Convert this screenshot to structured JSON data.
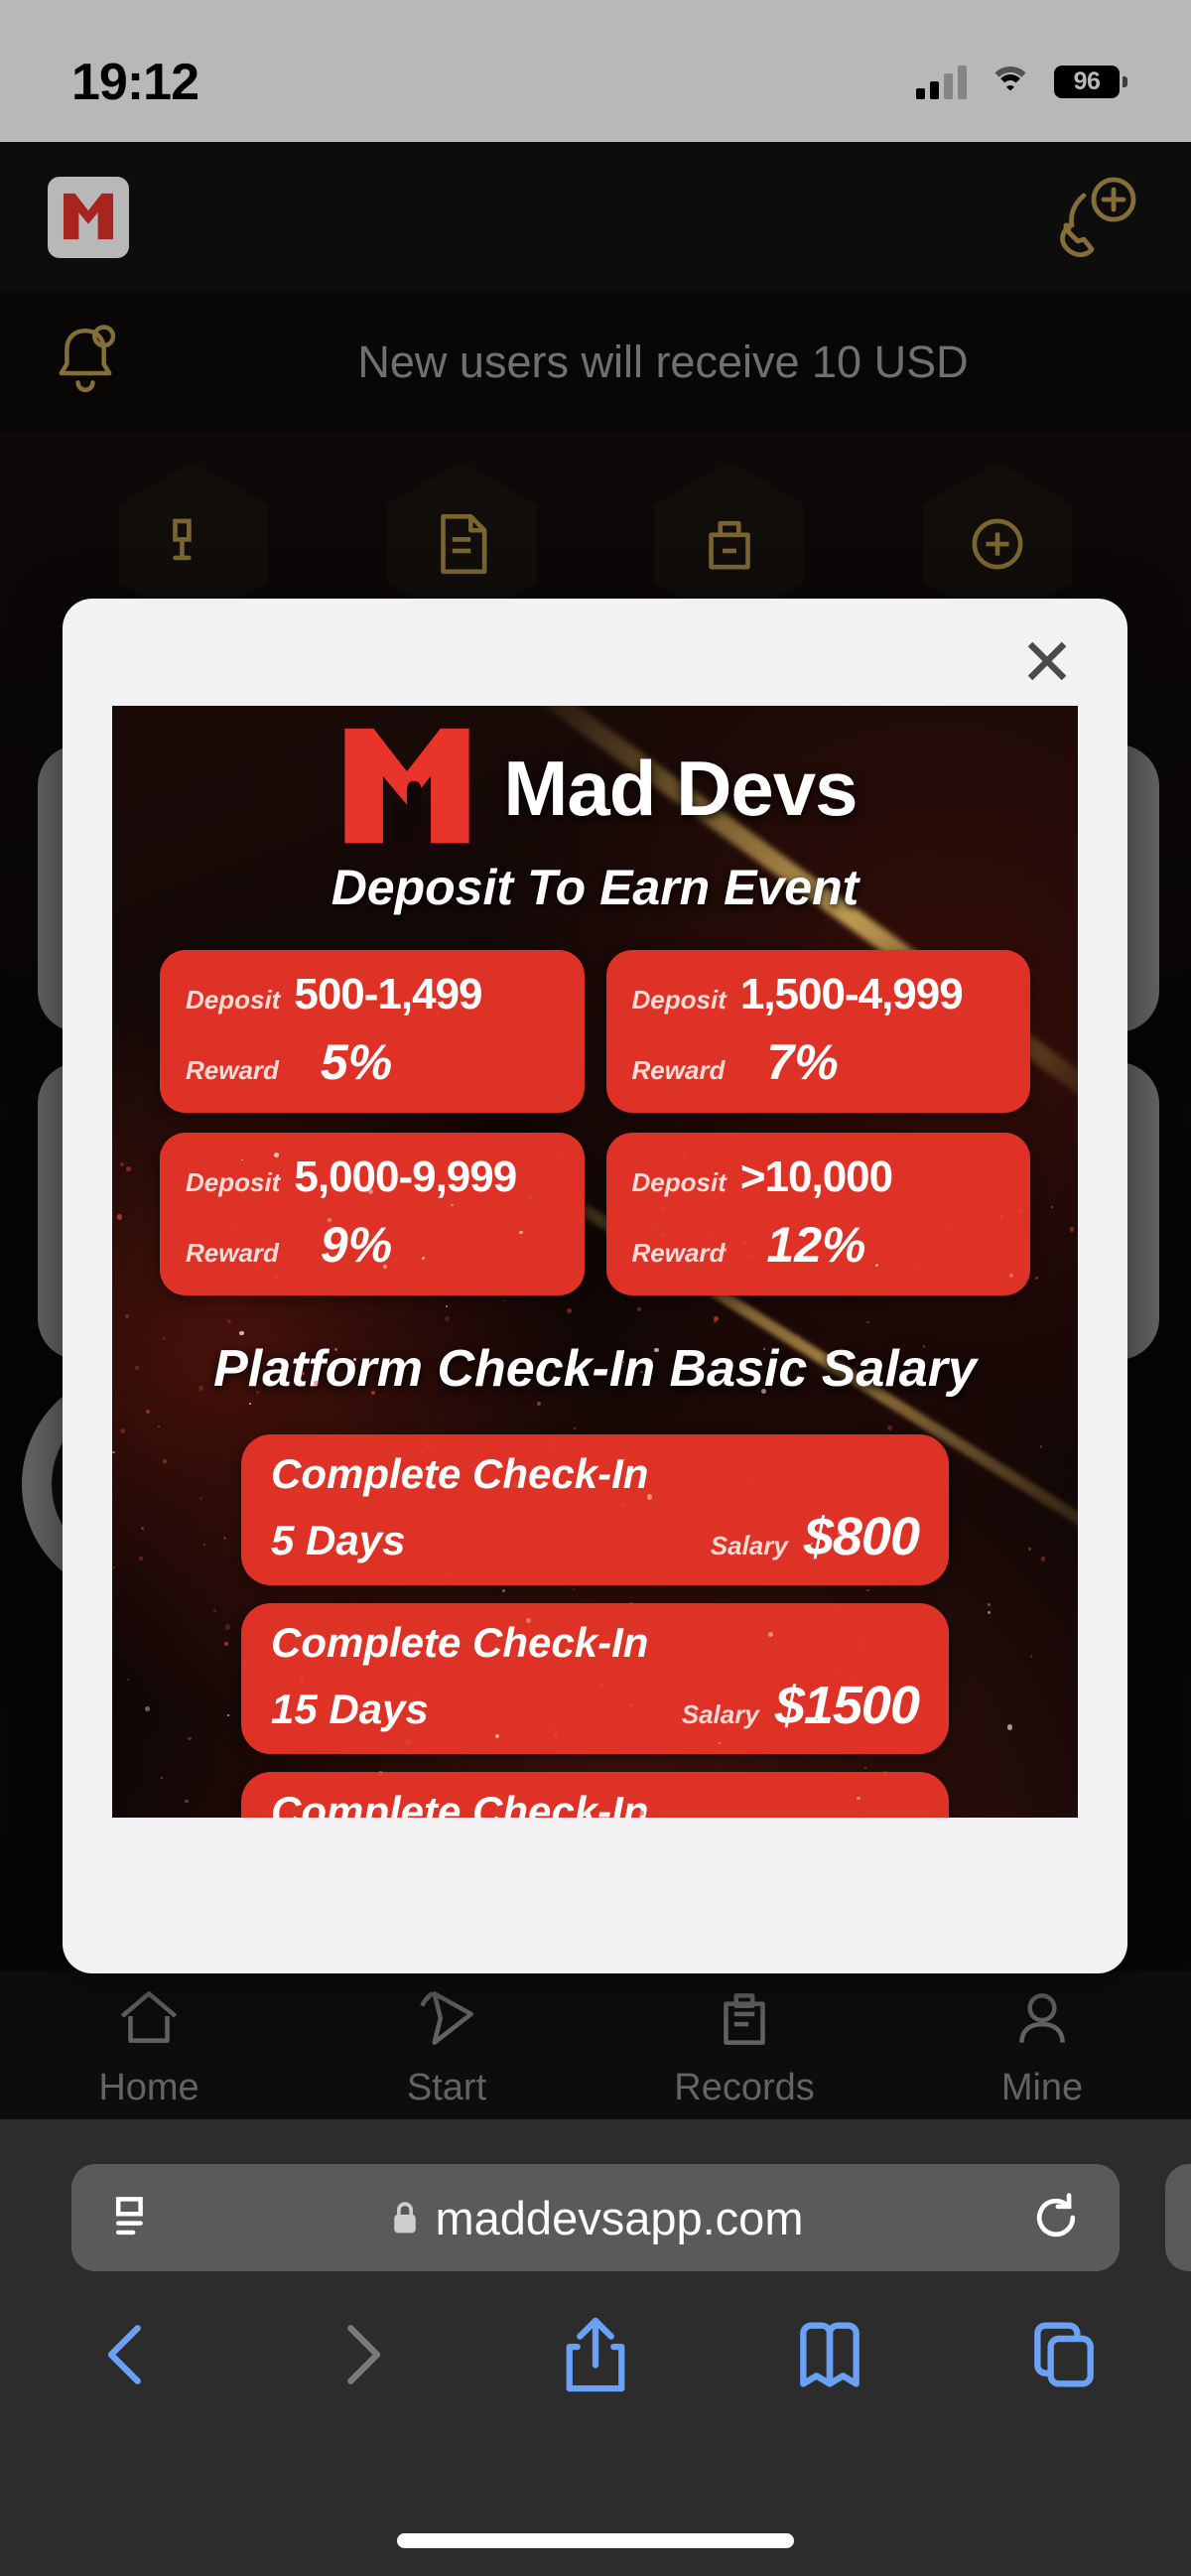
{
  "status_bar": {
    "time": "19:12",
    "battery_percent": "96",
    "signal_icon": "cellular-bars-icon",
    "wifi_icon": "wifi-icon",
    "battery_icon": "battery-icon"
  },
  "app_header": {
    "logo_icon": "mad-devs-m-logo",
    "support_icon": "customer-service-phone-icon"
  },
  "notice": {
    "bell_icon": "notification-bell-icon",
    "text": "New users will receive 10 USD"
  },
  "quick_actions": [
    {
      "name": "quick-action-qr",
      "icon": "qr-scan-icon"
    },
    {
      "name": "quick-action-document",
      "icon": "document-icon"
    },
    {
      "name": "quick-action-wallet",
      "icon": "wallet-person-icon"
    },
    {
      "name": "quick-action-add",
      "icon": "add-diamond-icon"
    }
  ],
  "modal": {
    "close_label": "✕",
    "brand_name": "Mad Devs",
    "brand_logo_icon": "mad-devs-rock-hand-logo",
    "event_title": "Deposit To Earn Event",
    "deposit_label": "Deposit",
    "reward_label": "Reward",
    "tiers": [
      {
        "deposit_label": "Deposit",
        "range": "500-1,499",
        "reward_label": "Reward",
        "reward": "5%"
      },
      {
        "deposit_label": "Deposit",
        "range": "1,500-4,999",
        "reward_label": "Reward",
        "reward": "7%"
      },
      {
        "deposit_label": "Deposit",
        "range": "5,000-9,999",
        "reward_label": "Reward",
        "reward": "9%"
      },
      {
        "deposit_label": "Deposit",
        "range": ">10,000",
        "reward_label": "Reward",
        "reward": "12%"
      }
    ],
    "checkin_section_title": "Platform Check-In Basic Salary",
    "checkins": [
      {
        "title": "Complete Check-In",
        "days": "5  Days",
        "salary_label": "Salary",
        "amount": "$800"
      },
      {
        "title": "Complete Check-In",
        "days": "15 Days",
        "salary_label": "Salary",
        "amount": "$1500"
      },
      {
        "title": "Complete Check-In",
        "days": "",
        "salary_label": "",
        "amount": ""
      }
    ]
  },
  "bottom_nav": [
    {
      "label": "Home",
      "icon": "home-icon"
    },
    {
      "label": "Start",
      "icon": "paper-plane-icon"
    },
    {
      "label": "Records",
      "icon": "records-clipboard-icon"
    },
    {
      "label": "Mine",
      "icon": "user-profile-icon"
    }
  ],
  "browser": {
    "page_settings_icon": "page-settings-icon",
    "lock_icon": "lock-icon",
    "url": "maddevsapp.com",
    "reload_icon": "reload-icon",
    "back_icon": "back-chevron-icon",
    "forward_icon": "forward-chevron-icon",
    "share_icon": "share-icon",
    "bookmarks_icon": "bookmarks-icon",
    "tabs_icon": "tabs-icon"
  },
  "colors": {
    "brand_red": "#df3226",
    "gold": "#c3a24f",
    "safari_blue": "#6aa0f5",
    "modal_bg": "#f2f2f5"
  }
}
